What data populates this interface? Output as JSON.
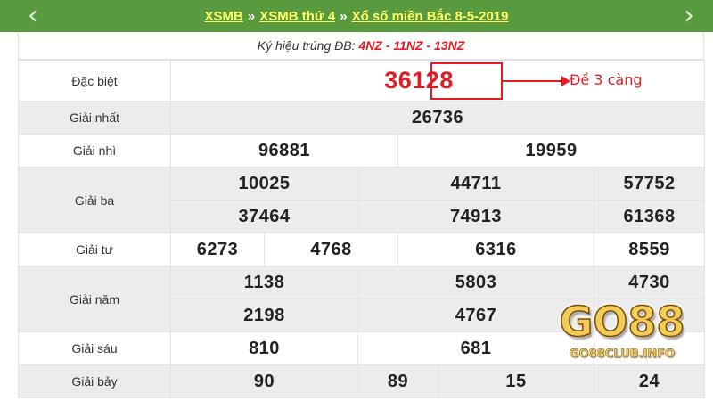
{
  "header": {
    "breadcrumb": [
      "XSMB",
      "XSMB thứ 4",
      "Xổ số miền Bắc 8-5-2019"
    ],
    "separator": "»",
    "prev_icon": "chevron-left-icon",
    "next_icon": "chevron-right-icon"
  },
  "subheader": {
    "label": "Ký hiệu trúng ĐB:",
    "codes": "4NZ - 11NZ - 13NZ"
  },
  "results": {
    "special": {
      "label": "Đặc biệt",
      "prefix": "36",
      "highlight": "128"
    },
    "first": {
      "label": "Giải nhất",
      "numbers": [
        "26736"
      ]
    },
    "second": {
      "label": "Giải nhì",
      "numbers": [
        "96881",
        "19959"
      ]
    },
    "third": {
      "label": "Giải ba",
      "numbers": [
        "10025",
        "44711",
        "57752",
        "37464",
        "74913",
        "61368"
      ]
    },
    "fourth": {
      "label": "Giải tư",
      "numbers": [
        "6273",
        "4768",
        "6316",
        "8559"
      ]
    },
    "fifth": {
      "label": "Giải năm",
      "numbers": [
        "1138",
        "5803",
        "4730",
        "2198",
        "4767",
        ""
      ]
    },
    "sixth": {
      "label": "Giải sáu",
      "numbers": [
        "810",
        "681",
        ""
      ]
    },
    "seventh": {
      "label": "Giải bảy",
      "numbers": [
        "90",
        "89",
        "15",
        "24"
      ]
    }
  },
  "annotation": {
    "text": "Đề 3 càng"
  },
  "watermark": {
    "logo": "GO88",
    "url": "GO88CLUB.INFO"
  },
  "colors": {
    "header_bg": "#5a9a3e",
    "header_link": "#ffff66",
    "accent_red": "#e31b23",
    "row_gray": "#ececec",
    "logo_gold": "#f3cb57"
  }
}
